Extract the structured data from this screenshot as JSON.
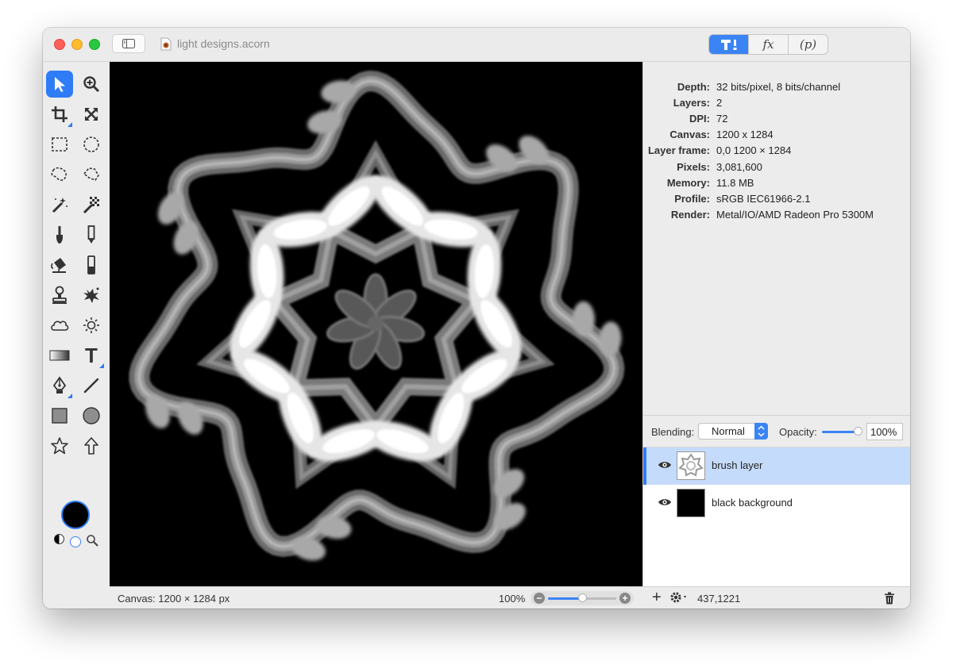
{
  "window": {
    "title": "light designs.acorn",
    "tabs": [
      {
        "label": "",
        "icon": "tools-icon",
        "active": true
      },
      {
        "label": "fx",
        "icon": "effects-icon",
        "active": false
      },
      {
        "label": "(p)",
        "icon": "plugins-icon",
        "active": false
      }
    ]
  },
  "tools": [
    {
      "name": "move-tool",
      "icon": "arrow-pointer-icon",
      "active": true
    },
    {
      "name": "zoom-tool",
      "icon": "magnifier-plus-icon"
    },
    {
      "name": "crop-tool",
      "icon": "crop-icon"
    },
    {
      "name": "transform-tool",
      "icon": "expand-arrows-icon"
    },
    {
      "name": "rect-select-tool",
      "icon": "dashed-rectangle-icon"
    },
    {
      "name": "ellipse-select-tool",
      "icon": "dashed-circle-icon"
    },
    {
      "name": "lasso-tool",
      "icon": "lasso-icon"
    },
    {
      "name": "polygon-lasso-tool",
      "icon": "polygon-lasso-icon"
    },
    {
      "name": "magic-wand-tool",
      "icon": "magic-wand-icon"
    },
    {
      "name": "instant-alpha-tool",
      "icon": "checker-wand-icon"
    },
    {
      "name": "brush-tool",
      "icon": "brush-icon"
    },
    {
      "name": "pencil-tool",
      "icon": "pencil-icon"
    },
    {
      "name": "paint-bucket-tool",
      "icon": "paint-bucket-icon"
    },
    {
      "name": "eraser-tool",
      "icon": "eraser-icon"
    },
    {
      "name": "clone-stamp-tool",
      "icon": "stamp-icon"
    },
    {
      "name": "healing-tool",
      "icon": "splatter-icon"
    },
    {
      "name": "smudge-tool",
      "icon": "cloud-icon"
    },
    {
      "name": "dodge-tool",
      "icon": "sun-icon"
    },
    {
      "name": "gradient-tool",
      "icon": "gradient-icon"
    },
    {
      "name": "text-tool",
      "icon": "text-t-icon",
      "label": "T"
    },
    {
      "name": "bezier-pen-tool",
      "icon": "pen-nib-icon"
    },
    {
      "name": "line-tool",
      "icon": "line-icon"
    },
    {
      "name": "rectangle-shape-tool",
      "icon": "square-icon"
    },
    {
      "name": "oval-shape-tool",
      "icon": "circle-icon"
    },
    {
      "name": "star-shape-tool",
      "icon": "star-icon"
    },
    {
      "name": "arrow-shape-tool",
      "icon": "up-arrow-icon"
    }
  ],
  "colors": {
    "foreground": "#000000",
    "background": "#ffffff",
    "accent": "#2f7cf6"
  },
  "info": [
    {
      "label": "Depth:",
      "value": "32 bits/pixel, 8 bits/channel"
    },
    {
      "label": "Layers:",
      "value": "2"
    },
    {
      "label": "DPI:",
      "value": "72"
    },
    {
      "label": "Canvas:",
      "value": "1200 x 1284"
    },
    {
      "label": "Layer frame:",
      "value": "0,0 1200 × 1284"
    },
    {
      "label": "Pixels:",
      "value": "3,081,600"
    },
    {
      "label": "Memory:",
      "value": "11.8 MB"
    },
    {
      "label": "Profile:",
      "value": "sRGB IEC61966-2.1"
    },
    {
      "label": "Render:",
      "value": "Metal/IO/AMD Radeon Pro 5300M"
    }
  ],
  "blending": {
    "label": "Blending:",
    "value": "Normal"
  },
  "opacity": {
    "label": "Opacity:",
    "value": "100%",
    "level": 1.0
  },
  "layers": [
    {
      "name": "brush layer",
      "selected": true,
      "visible": true
    },
    {
      "name": "black background",
      "selected": false,
      "visible": true
    }
  ],
  "status": {
    "canvas": "Canvas: 1200 × 1284 px",
    "zoom": "100%",
    "zoom_level": 0.5,
    "add_label": "+",
    "coords": "437,1221"
  }
}
